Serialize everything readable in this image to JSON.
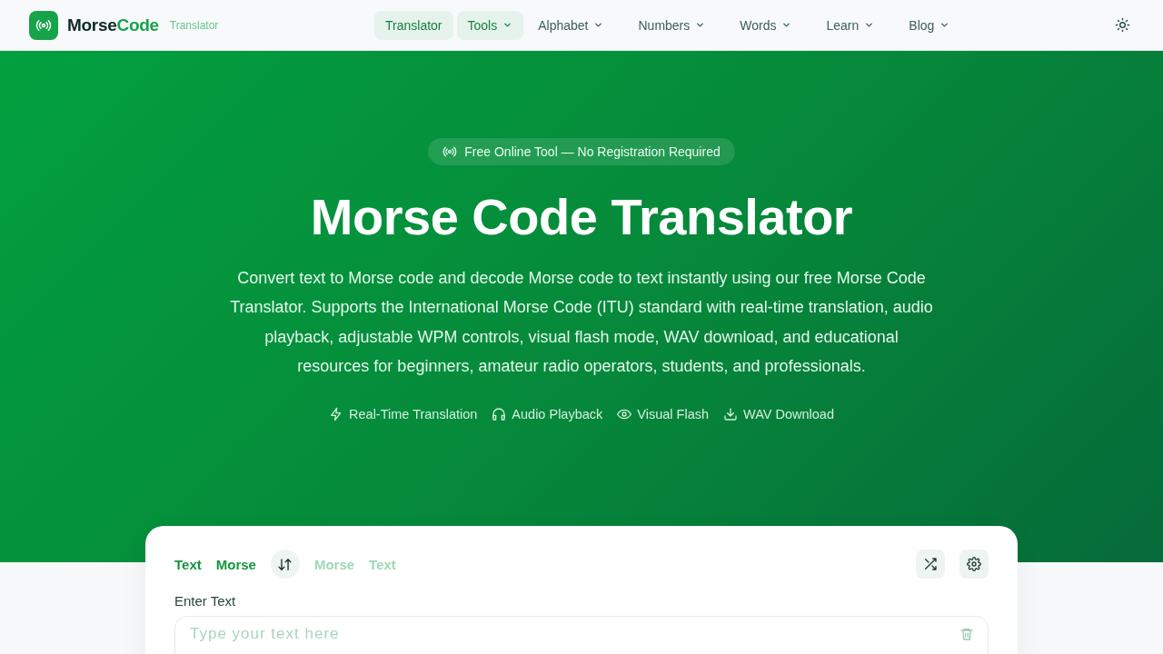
{
  "logo": {
    "name_dark": "Morse",
    "name_accent": "Code",
    "tagline": "Translator"
  },
  "nav": [
    {
      "label": "Translator",
      "selected": true,
      "has_menu": false
    },
    {
      "label": "Tools",
      "selected": true,
      "has_menu": true
    },
    {
      "label": "Alphabet",
      "selected": false,
      "has_menu": true
    },
    {
      "label": "Numbers",
      "selected": false,
      "has_menu": true
    },
    {
      "label": "Words",
      "selected": false,
      "has_menu": true
    },
    {
      "label": "Learn",
      "selected": false,
      "has_menu": true
    },
    {
      "label": "Blog",
      "selected": false,
      "has_menu": true
    }
  ],
  "hero": {
    "badge": "Free Online Tool — No Registration Required",
    "title": "Morse Code Translator",
    "description": "Convert text to Morse code and decode Morse code to text instantly using our free Morse Code Translator. Supports the International Morse Code (ITU) standard with real-time translation, audio playback, adjustable WPM controls, visual flash mode, WAV download, and educational resources for beginners, amateur radio operators, students, and professionals.",
    "features": [
      {
        "kind": "bolt",
        "label": "Real-Time Translation"
      },
      {
        "kind": "headphones",
        "label": "Audio Playback"
      },
      {
        "kind": "eye",
        "label": "Visual Flash"
      },
      {
        "kind": "download",
        "label": "WAV Download"
      }
    ]
  },
  "translator": {
    "modes": [
      {
        "from": "Text",
        "to": "Morse",
        "selected": true
      },
      {
        "from": "Morse",
        "to": "Text",
        "selected": false
      }
    ],
    "input_label": "Enter Text",
    "placeholder": "Type your text here"
  }
}
